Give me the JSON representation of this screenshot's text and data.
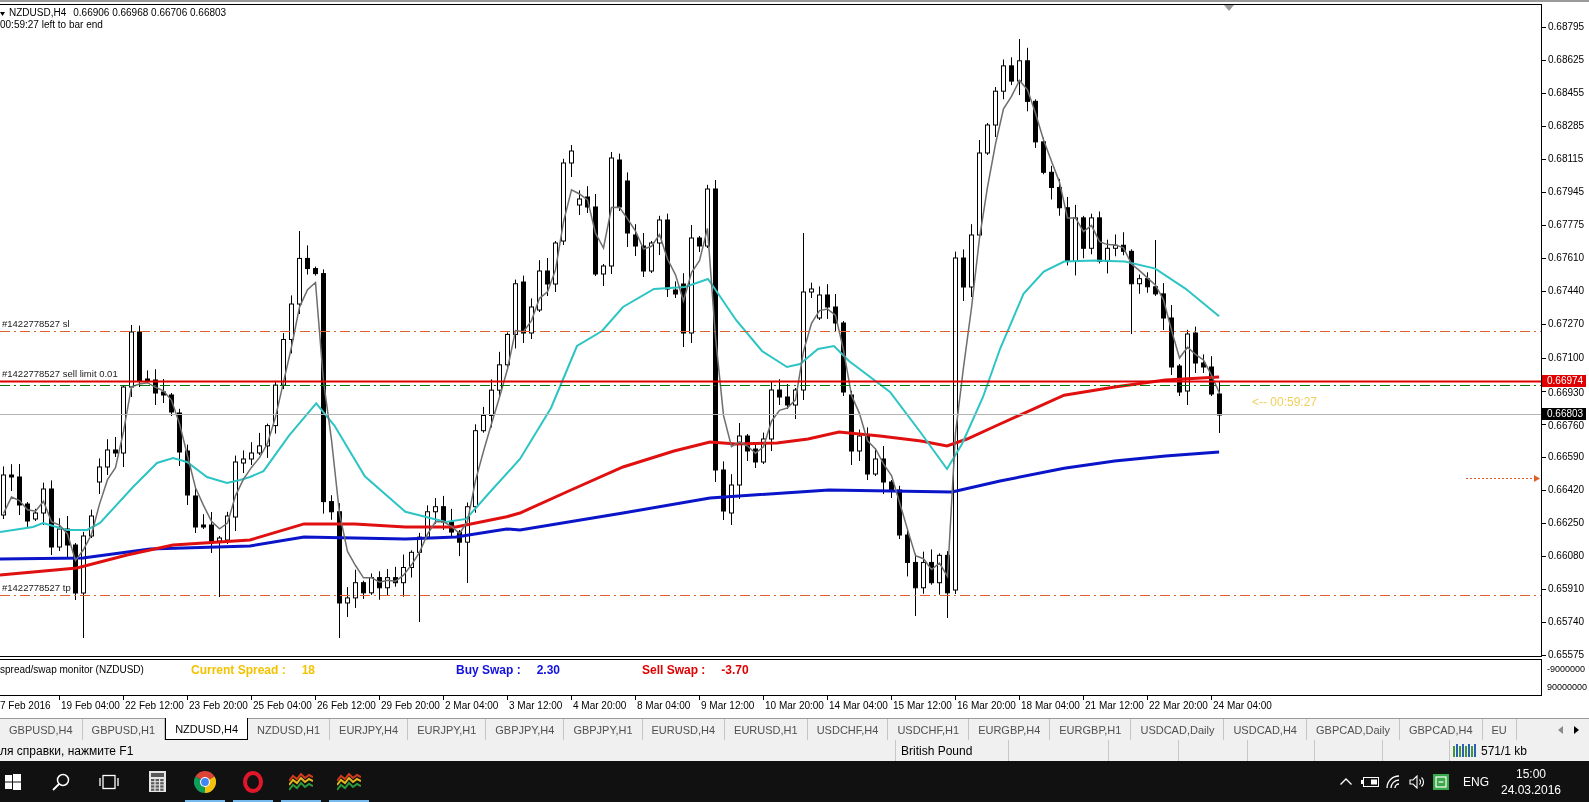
{
  "chart": {
    "symbol": "NZDUSD,H4",
    "ohlc": "0.66906 0.66968 0.66706 0.66803",
    "timer": "00:59:27 left to bar end",
    "order_lines": [
      {
        "kind": "sl",
        "label": "#1422778527 sl"
      },
      {
        "kind": "entry",
        "label": "#1422778527 sell limit 0.01"
      },
      {
        "kind": "tp",
        "label": "#1422778527 tp"
      }
    ],
    "countdown": "<-- 00:59:27",
    "price_axis": {
      "ticks": [
        "0.68795",
        "0.68625",
        "0.68455",
        "0.68285",
        "0.68115",
        "0.67945",
        "0.67775",
        "0.67610",
        "0.67440",
        "0.67270",
        "0.67100",
        "0.66930",
        "0.66760",
        "0.66590",
        "0.66420",
        "0.66250",
        "0.66080",
        "0.65910",
        "0.65740",
        "0.65575"
      ],
      "markers": [
        {
          "kind": "order",
          "text": "0.66974"
        },
        {
          "kind": "bid",
          "text": "0.66803"
        }
      ]
    }
  },
  "indicator": {
    "title": "spread/swap monitor (NZDUSD)",
    "fields": [
      {
        "label": "Current Spread :",
        "value": "18",
        "color": "#f2c200"
      },
      {
        "label": "Buy Swap :",
        "value": "2.30",
        "color": "#1010e0"
      },
      {
        "label": "Sell Swap :",
        "value": "-3.70",
        "color": "#e00000"
      }
    ],
    "axis_ticks": [
      "-9000000",
      "90000000"
    ]
  },
  "time_axis": {
    "ticks": [
      "7 Feb 2016",
      "19 Feb 04:00",
      "22 Feb 12:00",
      "23 Feb 20:00",
      "25 Feb 04:00",
      "26 Feb 12:00",
      "29 Feb 20:00",
      "2 Mar 04:00",
      "3 Mar 12:00",
      "4 Mar 20:00",
      "8 Mar 04:00",
      "9 Mar 12:00",
      "10 Mar 20:00",
      "14 Mar 04:00",
      "15 Mar 12:00",
      "16 Mar 20:00",
      "18 Mar 04:00",
      "21 Mar 12:00",
      "22 Mar 20:00",
      "24 Mar 04:00"
    ]
  },
  "tabs": [
    {
      "label": "GBPUSD,H4",
      "selected": false
    },
    {
      "label": "GBPUSD,H1",
      "selected": false
    },
    {
      "label": "NZDUSD,H4",
      "selected": true
    },
    {
      "label": "NZDUSD,H1",
      "selected": false
    },
    {
      "label": "EURJPY,H4",
      "selected": false
    },
    {
      "label": "EURJPY,H1",
      "selected": false
    },
    {
      "label": "GBPJPY,H4",
      "selected": false
    },
    {
      "label": "GBPJPY,H1",
      "selected": false
    },
    {
      "label": "EURUSD,H4",
      "selected": false
    },
    {
      "label": "EURUSD,H1",
      "selected": false
    },
    {
      "label": "USDCHF,H4",
      "selected": false
    },
    {
      "label": "USDCHF,H1",
      "selected": false
    },
    {
      "label": "EURGBP,H4",
      "selected": false
    },
    {
      "label": "EURGBP,H1",
      "selected": false
    },
    {
      "label": "USDCAD,Daily",
      "selected": false
    },
    {
      "label": "USDCAD,H4",
      "selected": false
    },
    {
      "label": "GBPCAD,Daily",
      "selected": false
    },
    {
      "label": "GBPCAD,H4",
      "selected": false
    },
    {
      "label": "EU",
      "selected": false
    }
  ],
  "status_bar": {
    "help": "ля справки, нажмите F1",
    "symbol": "British Pound",
    "traffic": "571/1 kb"
  },
  "taskbar": {
    "apps": [
      {
        "kind": "calculator",
        "running": false
      },
      {
        "kind": "chrome",
        "running": true
      },
      {
        "kind": "opera",
        "running": true
      },
      {
        "kind": "terminal",
        "running": true
      },
      {
        "kind": "terminal",
        "running": true
      }
    ],
    "language": "ENG",
    "time": "15:00",
    "date": "24.03.2016"
  }
}
